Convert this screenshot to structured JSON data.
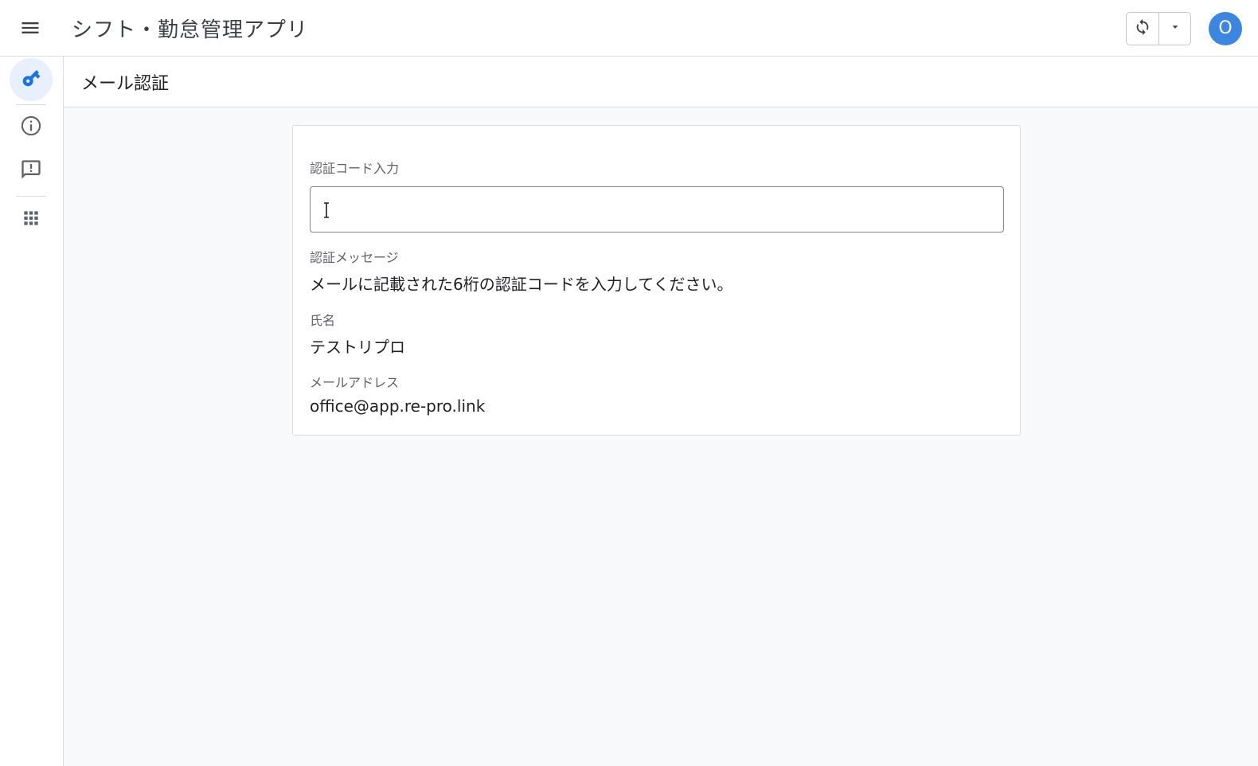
{
  "app": {
    "title": "シフト・勤怠管理アプリ"
  },
  "topbar": {
    "menu_icon": "hamburger-menu-icon",
    "refresh_icon": "sync-icon",
    "dropdown_icon": "caret-down-icon",
    "avatar_initial": "O",
    "avatar_color": "#3a86e0"
  },
  "rail": {
    "items": [
      {
        "icon": "key-icon",
        "active": true
      },
      {
        "icon": "info-icon",
        "active": false
      },
      {
        "icon": "feedback-icon",
        "active": false
      },
      {
        "icon": "apps-grid-icon",
        "active": false
      }
    ],
    "accent_color": "#1a73e8"
  },
  "page": {
    "title": "メール認証"
  },
  "form": {
    "code_label": "認証コード入力",
    "code_value": "",
    "code_placeholder": "",
    "message_label": "認証メッセージ",
    "message_value": "メールに記載された6桁の認証コードを入力してください。",
    "name_label": "氏名",
    "name_value": "テストリプロ",
    "email_label": "メールアドレス",
    "email_value": "office@app.re-pro.link"
  }
}
